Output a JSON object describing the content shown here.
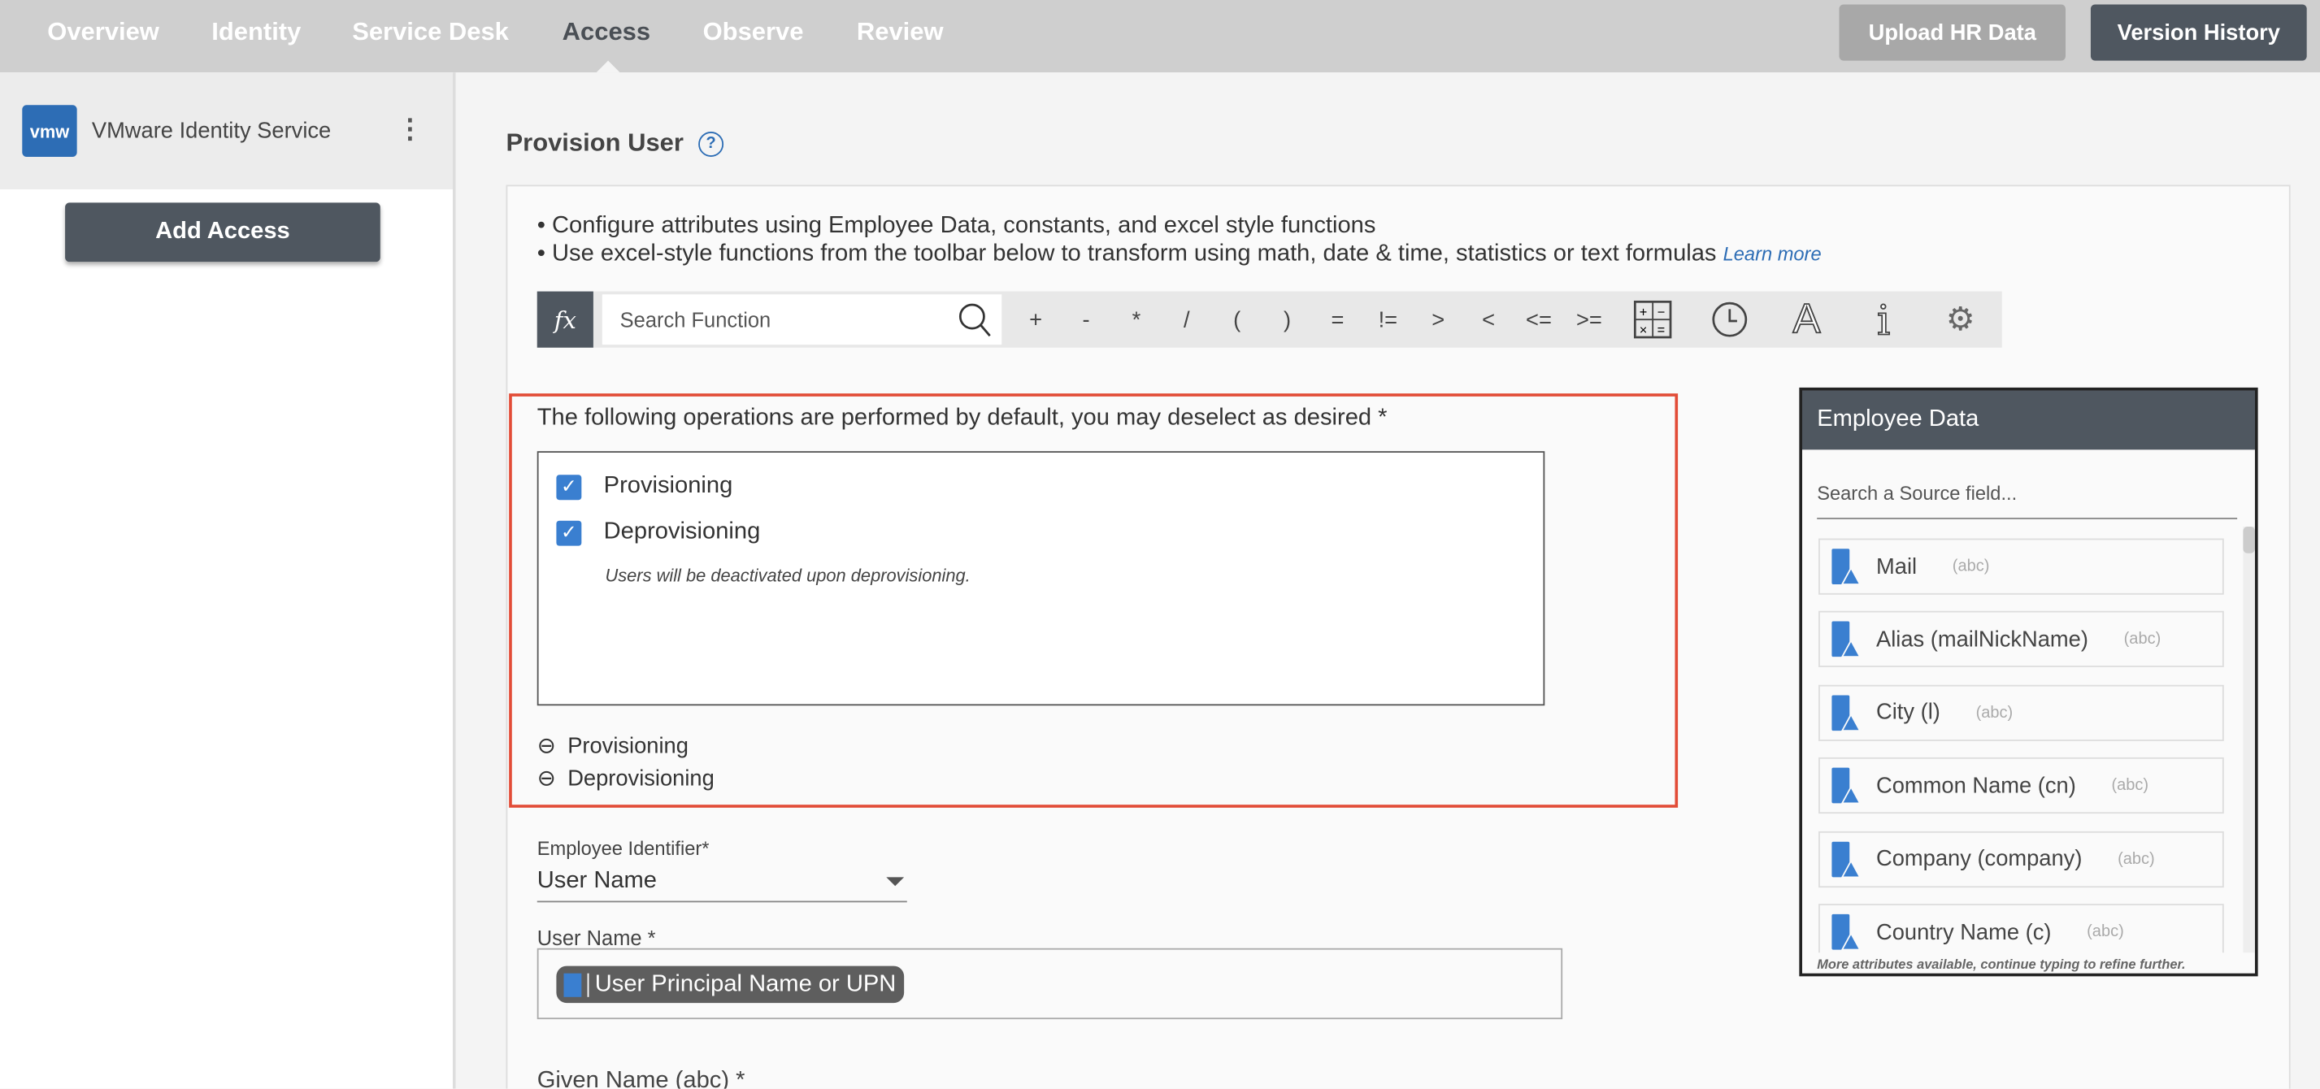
{
  "nav": {
    "tabs": [
      "Overview",
      "Identity",
      "Service Desk",
      "Access",
      "Observe",
      "Review"
    ],
    "active": "Access",
    "upload_label": "Upload HR Data",
    "version_label": "Version History"
  },
  "sidebar": {
    "logo_text": "vmw",
    "app_name": "VMware Identity Service",
    "add_access_label": "Add Access"
  },
  "main": {
    "title": "Provision User",
    "bullets": [
      "Configure attributes using Employee Data, constants, and excel style functions",
      "Use excel-style functions from the toolbar below to transform using math, date & time, statistics or text formulas"
    ],
    "learn_more": "Learn more",
    "toolbar": {
      "fx": "fx",
      "search_placeholder": "Search Function",
      "operators": [
        "+",
        "-",
        "*",
        "/",
        "(",
        ")",
        "=",
        "!=",
        ">",
        "<",
        "<=",
        ">="
      ],
      "icons": [
        "calculator-icon",
        "clock-icon",
        "text-icon",
        "info-icon",
        "brain-icon"
      ]
    },
    "operations": {
      "heading": "The following operations are performed by default, you may deselect as desired *",
      "options": [
        {
          "label": "Provisioning",
          "checked": true
        },
        {
          "label": "Deprovisioning",
          "checked": true
        }
      ],
      "note": "Users will be deactivated upon deprovisioning.",
      "collapsed": [
        "Provisioning",
        "Deprovisioning"
      ]
    },
    "employee_identifier": {
      "label": "Employee Identifier*",
      "value": "User Name"
    },
    "user_name": {
      "label": "User Name *",
      "chip": "User Principal Name or UPN"
    },
    "given_name": {
      "label": "Given Name (abc) *"
    }
  },
  "employee_data": {
    "title": "Employee Data",
    "search_placeholder": "Search a Source field...",
    "fields": [
      {
        "name": "Mail",
        "type": "(abc)"
      },
      {
        "name": "Alias (mailNickName)",
        "type": "(abc)"
      },
      {
        "name": "City (l)",
        "type": "(abc)"
      },
      {
        "name": "Common Name (cn)",
        "type": "(abc)"
      },
      {
        "name": "Company (company)",
        "type": "(abc)"
      },
      {
        "name": "Country Name (c)",
        "type": "(abc)"
      }
    ],
    "footer": "More attributes available, continue typing to refine further."
  },
  "colors": {
    "accent": "#3a7fd0",
    "highlight": "#e24c37",
    "header_dark": "#4f5760"
  }
}
